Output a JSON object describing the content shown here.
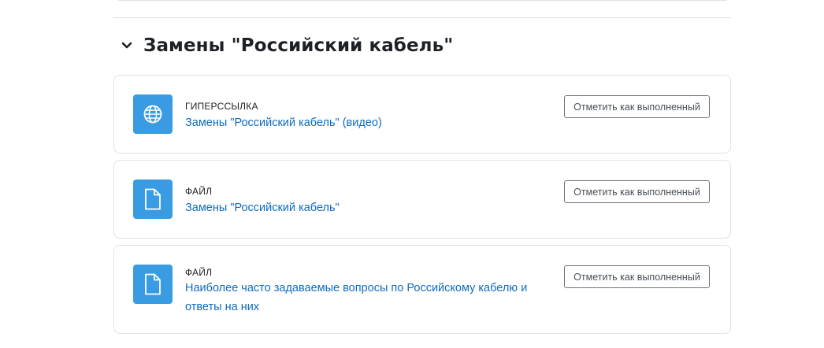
{
  "section": {
    "title": "Замены \"Российский кабель\"",
    "collapse_icon": "chevron-down-icon"
  },
  "activities": [
    {
      "type": "Гиперссылка",
      "name": "Замены \"Российский кабель\" (видео)",
      "icon": "globe-icon",
      "completion_label": "Отметить как выполненный"
    },
    {
      "type": "Файл",
      "name": "Замены \"Российский кабель\"",
      "icon": "file-icon",
      "completion_label": "Отметить как выполненный"
    },
    {
      "type": "Файл",
      "name_line1": "Наиболее часто задаваемые вопросы по Российскому кабелю и",
      "name_line2": "ответы на них",
      "icon": "file-icon",
      "completion_label": "Отметить как выполненный"
    }
  ],
  "colors": {
    "icon_background": "#399be2",
    "link": "#0f6cbf",
    "border": "#dee2e6"
  }
}
